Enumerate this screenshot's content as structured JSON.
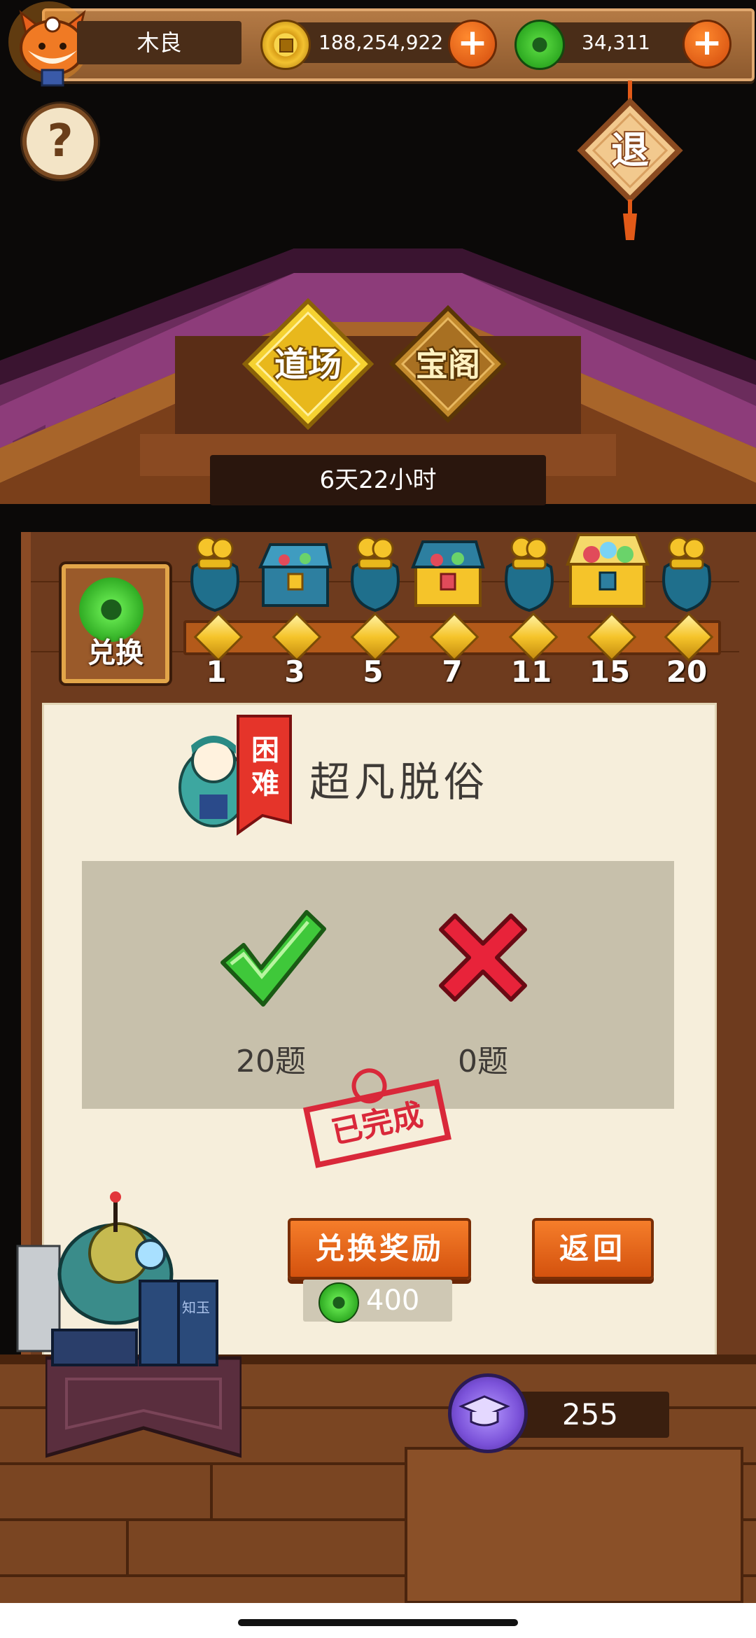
{
  "topbar": {
    "player_name": "木良",
    "coins": "188,254,922",
    "jade": "34,311"
  },
  "exit_label": "退",
  "tabs": [
    {
      "label": "道场"
    },
    {
      "label": "宝阁"
    }
  ],
  "timer": "6天22小时",
  "exchange": {
    "label": "兑换"
  },
  "milestones": [
    "1",
    "3",
    "5",
    "7",
    "11",
    "15",
    "20"
  ],
  "level": {
    "difficulty": "困难",
    "title": "超凡脱俗"
  },
  "results": {
    "correct": "20题",
    "wrong": "0题"
  },
  "stamp": "已完成",
  "buttons": {
    "exchange_reward": "兑换奖励",
    "return": "返回"
  },
  "cost": "400",
  "score": "255",
  "book_label": "知玉",
  "colors": {
    "accent_orange": "#e8661c",
    "wood": "#6e3b1e",
    "paper": "#f6eedb",
    "jade": "#2eaa22",
    "gold": "#f5c42a"
  }
}
